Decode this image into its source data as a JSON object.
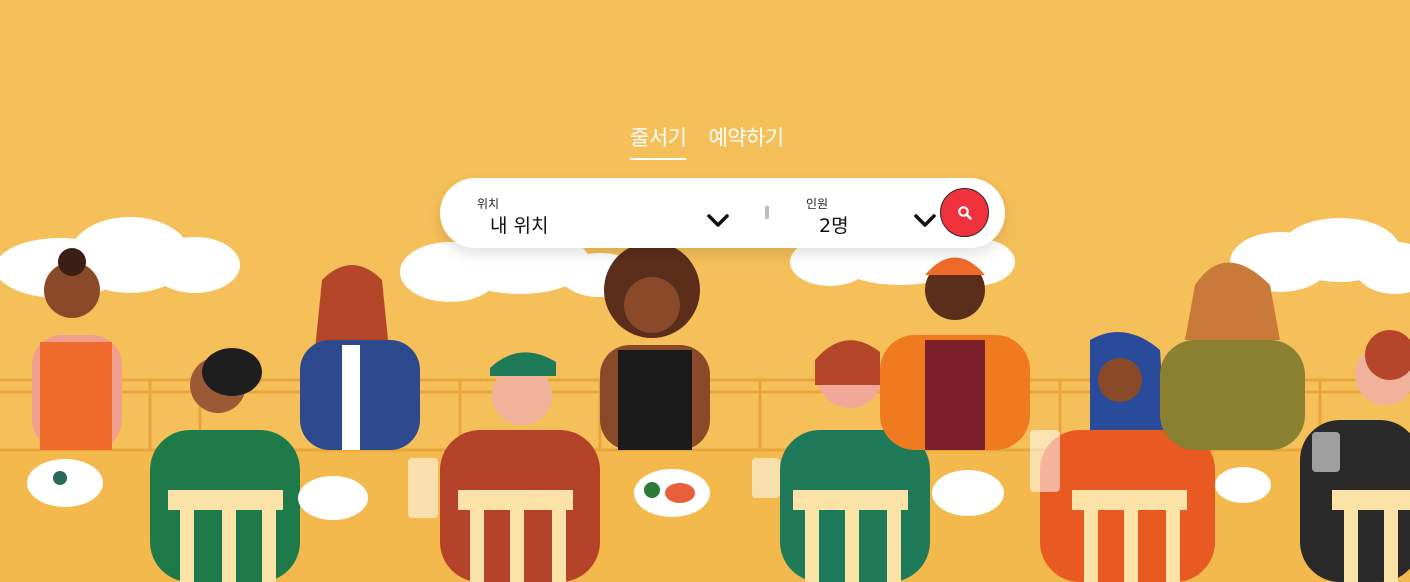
{
  "tabs": [
    {
      "label": "줄서기",
      "active": true
    },
    {
      "label": "예약하기",
      "active": false
    }
  ],
  "search": {
    "location": {
      "label": "위치",
      "value": "내 위치"
    },
    "people": {
      "label": "인원",
      "value": "2명"
    },
    "button_icon": "search-icon"
  },
  "colors": {
    "background": "#f5c05a",
    "search_button": "#f0323c",
    "cloud": "#ffffff"
  }
}
